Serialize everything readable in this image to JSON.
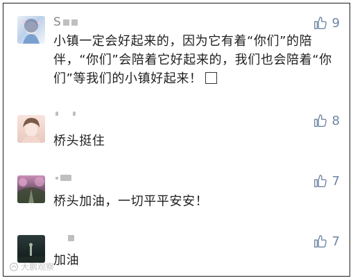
{
  "comments": [
    {
      "username": "S",
      "likes": "9",
      "text": "小镇一定会好起来的，因为它有着“你们”的陪伴，“你们”会陪着它好起来的，我们也会陪着“你们”等我们的小镇好起来！"
    },
    {
      "username": "",
      "likes": "8",
      "text": "桥头挺住"
    },
    {
      "username": "",
      "likes": "7",
      "text": "桥头加油，一切平平安安！"
    },
    {
      "username": "",
      "likes": "7",
      "text": "加油"
    }
  ],
  "colors": {
    "like_icon": "#6e86a3",
    "username": "#888888",
    "text": "#1f1f1f"
  },
  "icons": {
    "like": "thumbs-up-icon",
    "check": "checkbox-icon",
    "watermark": "watermark-logo"
  },
  "watermark": {
    "text": "大鹏观察"
  }
}
